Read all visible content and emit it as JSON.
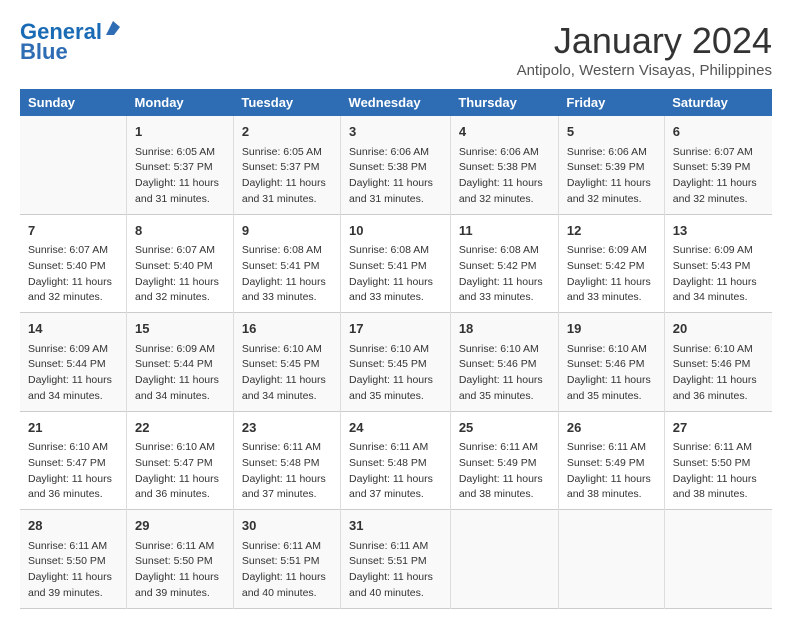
{
  "header": {
    "logo_line1": "General",
    "logo_line2": "Blue",
    "month_title": "January 2024",
    "subtitle": "Antipolo, Western Visayas, Philippines"
  },
  "days_of_week": [
    "Sunday",
    "Monday",
    "Tuesday",
    "Wednesday",
    "Thursday",
    "Friday",
    "Saturday"
  ],
  "weeks": [
    [
      {
        "day": "",
        "info": ""
      },
      {
        "day": "1",
        "info": "Sunrise: 6:05 AM\nSunset: 5:37 PM\nDaylight: 11 hours\nand 31 minutes."
      },
      {
        "day": "2",
        "info": "Sunrise: 6:05 AM\nSunset: 5:37 PM\nDaylight: 11 hours\nand 31 minutes."
      },
      {
        "day": "3",
        "info": "Sunrise: 6:06 AM\nSunset: 5:38 PM\nDaylight: 11 hours\nand 31 minutes."
      },
      {
        "day": "4",
        "info": "Sunrise: 6:06 AM\nSunset: 5:38 PM\nDaylight: 11 hours\nand 32 minutes."
      },
      {
        "day": "5",
        "info": "Sunrise: 6:06 AM\nSunset: 5:39 PM\nDaylight: 11 hours\nand 32 minutes."
      },
      {
        "day": "6",
        "info": "Sunrise: 6:07 AM\nSunset: 5:39 PM\nDaylight: 11 hours\nand 32 minutes."
      }
    ],
    [
      {
        "day": "7",
        "info": "Sunrise: 6:07 AM\nSunset: 5:40 PM\nDaylight: 11 hours\nand 32 minutes."
      },
      {
        "day": "8",
        "info": "Sunrise: 6:07 AM\nSunset: 5:40 PM\nDaylight: 11 hours\nand 32 minutes."
      },
      {
        "day": "9",
        "info": "Sunrise: 6:08 AM\nSunset: 5:41 PM\nDaylight: 11 hours\nand 33 minutes."
      },
      {
        "day": "10",
        "info": "Sunrise: 6:08 AM\nSunset: 5:41 PM\nDaylight: 11 hours\nand 33 minutes."
      },
      {
        "day": "11",
        "info": "Sunrise: 6:08 AM\nSunset: 5:42 PM\nDaylight: 11 hours\nand 33 minutes."
      },
      {
        "day": "12",
        "info": "Sunrise: 6:09 AM\nSunset: 5:42 PM\nDaylight: 11 hours\nand 33 minutes."
      },
      {
        "day": "13",
        "info": "Sunrise: 6:09 AM\nSunset: 5:43 PM\nDaylight: 11 hours\nand 34 minutes."
      }
    ],
    [
      {
        "day": "14",
        "info": "Sunrise: 6:09 AM\nSunset: 5:44 PM\nDaylight: 11 hours\nand 34 minutes."
      },
      {
        "day": "15",
        "info": "Sunrise: 6:09 AM\nSunset: 5:44 PM\nDaylight: 11 hours\nand 34 minutes."
      },
      {
        "day": "16",
        "info": "Sunrise: 6:10 AM\nSunset: 5:45 PM\nDaylight: 11 hours\nand 34 minutes."
      },
      {
        "day": "17",
        "info": "Sunrise: 6:10 AM\nSunset: 5:45 PM\nDaylight: 11 hours\nand 35 minutes."
      },
      {
        "day": "18",
        "info": "Sunrise: 6:10 AM\nSunset: 5:46 PM\nDaylight: 11 hours\nand 35 minutes."
      },
      {
        "day": "19",
        "info": "Sunrise: 6:10 AM\nSunset: 5:46 PM\nDaylight: 11 hours\nand 35 minutes."
      },
      {
        "day": "20",
        "info": "Sunrise: 6:10 AM\nSunset: 5:46 PM\nDaylight: 11 hours\nand 36 minutes."
      }
    ],
    [
      {
        "day": "21",
        "info": "Sunrise: 6:10 AM\nSunset: 5:47 PM\nDaylight: 11 hours\nand 36 minutes."
      },
      {
        "day": "22",
        "info": "Sunrise: 6:10 AM\nSunset: 5:47 PM\nDaylight: 11 hours\nand 36 minutes."
      },
      {
        "day": "23",
        "info": "Sunrise: 6:11 AM\nSunset: 5:48 PM\nDaylight: 11 hours\nand 37 minutes."
      },
      {
        "day": "24",
        "info": "Sunrise: 6:11 AM\nSunset: 5:48 PM\nDaylight: 11 hours\nand 37 minutes."
      },
      {
        "day": "25",
        "info": "Sunrise: 6:11 AM\nSunset: 5:49 PM\nDaylight: 11 hours\nand 38 minutes."
      },
      {
        "day": "26",
        "info": "Sunrise: 6:11 AM\nSunset: 5:49 PM\nDaylight: 11 hours\nand 38 minutes."
      },
      {
        "day": "27",
        "info": "Sunrise: 6:11 AM\nSunset: 5:50 PM\nDaylight: 11 hours\nand 38 minutes."
      }
    ],
    [
      {
        "day": "28",
        "info": "Sunrise: 6:11 AM\nSunset: 5:50 PM\nDaylight: 11 hours\nand 39 minutes."
      },
      {
        "day": "29",
        "info": "Sunrise: 6:11 AM\nSunset: 5:50 PM\nDaylight: 11 hours\nand 39 minutes."
      },
      {
        "day": "30",
        "info": "Sunrise: 6:11 AM\nSunset: 5:51 PM\nDaylight: 11 hours\nand 40 minutes."
      },
      {
        "day": "31",
        "info": "Sunrise: 6:11 AM\nSunset: 5:51 PM\nDaylight: 11 hours\nand 40 minutes."
      },
      {
        "day": "",
        "info": ""
      },
      {
        "day": "",
        "info": ""
      },
      {
        "day": "",
        "info": ""
      }
    ]
  ]
}
